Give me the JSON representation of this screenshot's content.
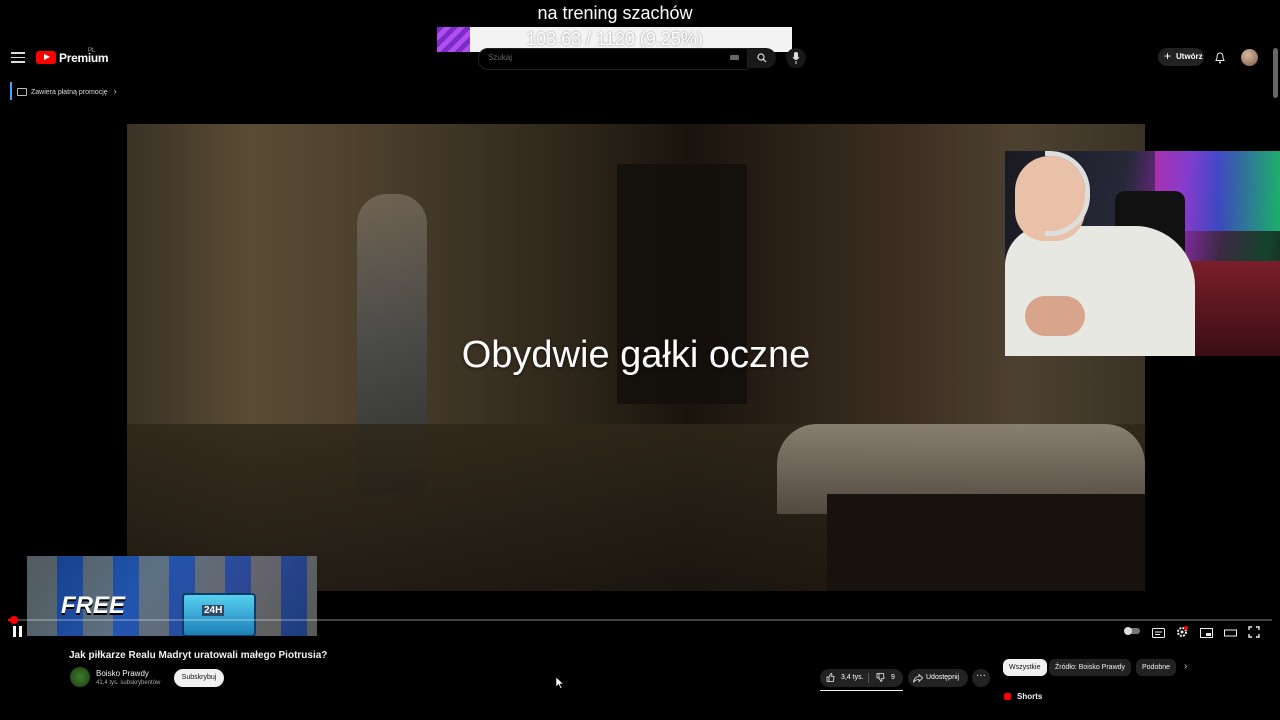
{
  "stream_overlay": {
    "goal_title": "na trening szachów",
    "goal_progress_text": "103.63 / 1120 (9.25%)",
    "goal_progress_fraction": 0.0925
  },
  "header": {
    "logo_text": "Premium",
    "logo_region": "PL",
    "search_placeholder": "Szukaj",
    "create_label": "Utwórz"
  },
  "paid_promotion": {
    "label": "Zawiera płatną promocję",
    "chevron": "›"
  },
  "video": {
    "subtitle": "Obydwie gałki oczne",
    "ad_thumbnail": {
      "text": "FREE",
      "box_label": "24H"
    },
    "progress_fraction": 0.005
  },
  "info": {
    "title": "Jak piłkarze Realu Madryt uratowali małego Piotrusia?",
    "channel_name": "Boisko Prawdy",
    "channel_subs": "41,4 tys. subskrybentów",
    "subscribe_label": "Subskrybuj",
    "like_count": "3,4 tys.",
    "dislike_count": "9",
    "share_label": "Udostępnij",
    "more_label": "···"
  },
  "sidebar": {
    "chips": [
      {
        "label": "Wszystkie"
      },
      {
        "label": "Źródło: Boisko Prawdy"
      },
      {
        "label": "Podobne"
      }
    ],
    "chip_next": "›",
    "shorts_label": "Shorts"
  },
  "colors": {
    "accent_red": "#ff0000",
    "goal_purple": "#9a3fe0",
    "promo_blue": "#3ea6ff"
  },
  "icons": [
    "menu-icon",
    "search-icon",
    "mic-icon",
    "keyboard-icon",
    "bell-icon",
    "pause-icon",
    "subtitles-icon",
    "settings-icon",
    "miniplayer-icon",
    "theater-icon",
    "fullscreen-icon",
    "like-icon",
    "dislike-icon",
    "share-icon"
  ]
}
